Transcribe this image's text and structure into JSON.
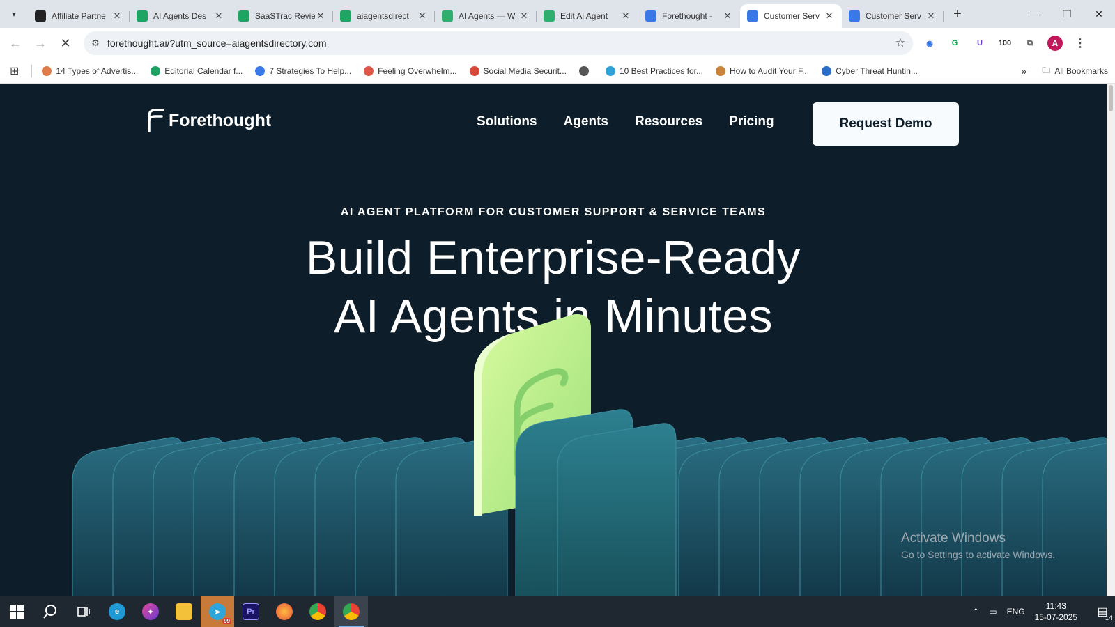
{
  "browser": {
    "tabs": [
      {
        "title": "Affiliate Partne",
        "favicon": "openai-icon",
        "color": "#222222",
        "active": false
      },
      {
        "title": "AI Agents Des",
        "favicon": "sheets-icon",
        "color": "#1fa463",
        "active": false
      },
      {
        "title": "SaaSTrac Revie",
        "favicon": "sheets-icon",
        "color": "#1fa463",
        "active": false
      },
      {
        "title": "aiagentsdirect",
        "favicon": "sheets-icon",
        "color": "#1fa463",
        "active": false
      },
      {
        "title": "AI Agents — W",
        "favicon": "star-icon",
        "color": "#2fae6e",
        "active": false
      },
      {
        "title": "Edit Ai Agent",
        "favicon": "star-icon",
        "color": "#2fae6e",
        "active": false
      },
      {
        "title": "Forethought -",
        "favicon": "docs-icon",
        "color": "#3b78e7",
        "active": false
      },
      {
        "title": "Customer Serv",
        "favicon": "forethought-icon",
        "color": "#3b78e7",
        "active": true
      },
      {
        "title": "Customer Serv",
        "favicon": "forethought-icon",
        "color": "#3b78e7",
        "active": false
      }
    ],
    "url": "forethought.ai/?utm_source=aiagentsdirectory.com",
    "bookmarks": [
      {
        "label": "14 Types of Advertis...",
        "color": "#e07b4a"
      },
      {
        "label": "Editorial Calendar f...",
        "color": "#1fa463"
      },
      {
        "label": "7 Strategies To Help...",
        "color": "#3b78e7"
      },
      {
        "label": "Feeling Overwhelm...",
        "color": "#e0584a"
      },
      {
        "label": "Social Media Securit...",
        "color": "#d94a3b"
      },
      {
        "label": "",
        "color": "#555555"
      },
      {
        "label": "10 Best Practices for...",
        "color": "#2fa3d9"
      },
      {
        "label": "How to Audit Your F...",
        "color": "#c8843a"
      },
      {
        "label": "Cyber Threat Huntin...",
        "color": "#2a6ec9"
      }
    ],
    "all_bookmarks": "All Bookmarks",
    "extensions": [
      "100"
    ],
    "profile_initial": "A"
  },
  "site": {
    "logo": "Forethought",
    "menu": [
      "Solutions",
      "Agents",
      "Resources",
      "Pricing"
    ],
    "cta": "Request Demo",
    "eyebrow": "AI AGENT PLATFORM FOR CUSTOMER SUPPORT & SERVICE TEAMS",
    "headline_line1": "Build Enterprise-Ready",
    "headline_line2": "AI Agents in Minutes",
    "colors": {
      "background": "#0d1e2a",
      "accent_card": "#c8f58a",
      "panels": "#1f5f6e"
    }
  },
  "watermark": {
    "line1": "Activate Windows",
    "line2": "Go to Settings to activate Windows."
  },
  "taskbar": {
    "apps": [
      "windows-start-icon",
      "search-icon",
      "task-view-icon",
      "edge-icon",
      "copilot-icon",
      "file-explorer-icon",
      "telegram-icon",
      "premiere-icon",
      "firefox-icon",
      "chrome-icon",
      "chrome-profile-icon"
    ],
    "telegram_badge": "99",
    "language": "ENG",
    "time": "11:43",
    "date": "15-07-2025",
    "notifications": "14"
  }
}
